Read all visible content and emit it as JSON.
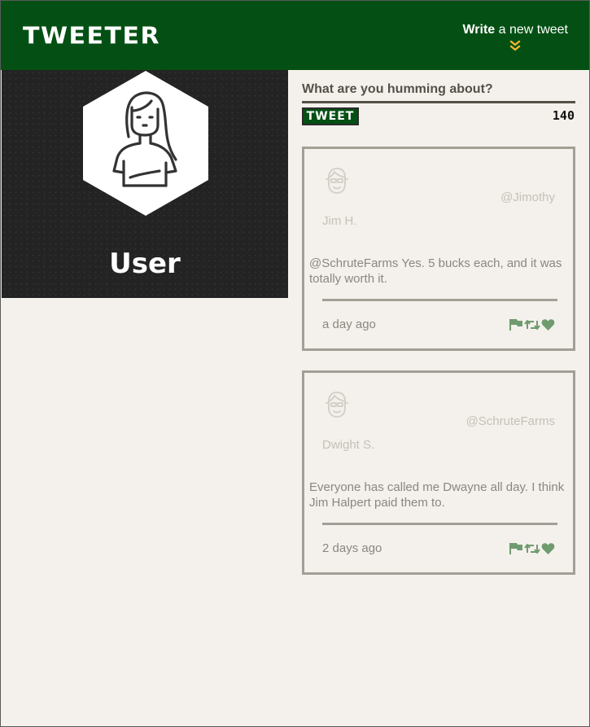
{
  "header": {
    "brand": "TWEETER",
    "compose_bold": "Write",
    "compose_rest": " a new tweet",
    "compose_icon": "double-chevron-down-icon"
  },
  "profile": {
    "name": "User",
    "avatar_icon": "user-avatar-icon"
  },
  "composer": {
    "prompt": "What are you humming about?",
    "input_value": "",
    "tweet_button": "TWEET",
    "char_count": "140"
  },
  "tweets": [
    {
      "handle": "@Jimothy",
      "name": "Jim H.",
      "text": "@SchruteFarms Yes. 5 bucks each, and it was totally worth it.",
      "time": "a day ago",
      "actions": [
        "flag-icon",
        "retweet-icon",
        "heart-icon"
      ]
    },
    {
      "handle": "@SchruteFarms",
      "name": "Dwight S.",
      "text": "Everyone has called me Dwayne all day. I think Jim Halpert paid them to.",
      "time": "2 days ago",
      "actions": [
        "flag-icon",
        "retweet-icon",
        "heart-icon"
      ]
    }
  ],
  "colors": {
    "header_bg": "#045014",
    "accent_chevron": "#f2b632",
    "page_bg": "#f4f1ec",
    "profile_bg": "#232323",
    "action_icons": "#6f9b6f",
    "card_border": "#a29f97"
  }
}
